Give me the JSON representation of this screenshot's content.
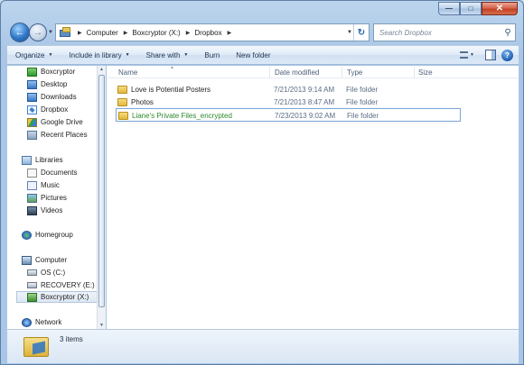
{
  "address": {
    "crumbs": [
      "Computer",
      "Boxcryptor (X:)",
      "Dropbox"
    ]
  },
  "search": {
    "placeholder": "Search Dropbox"
  },
  "toolbar": {
    "organize": "Organize",
    "include_in_library": "Include in library",
    "share_with": "Share with",
    "burn": "Burn",
    "new_folder": "New folder"
  },
  "sidebar": {
    "favorites": [
      {
        "label": "Boxcryptor",
        "icon": "boxcryptor-icon"
      },
      {
        "label": "Desktop",
        "icon": "desktop-icon"
      },
      {
        "label": "Downloads",
        "icon": "downloads-icon"
      },
      {
        "label": "Dropbox",
        "icon": "dropbox-icon"
      },
      {
        "label": "Google Drive",
        "icon": "google-drive-icon"
      },
      {
        "label": "Recent Places",
        "icon": "recent-places-icon"
      }
    ],
    "libraries": {
      "label": "Libraries",
      "items": [
        {
          "label": "Documents",
          "icon": "documents-icon"
        },
        {
          "label": "Music",
          "icon": "music-icon"
        },
        {
          "label": "Pictures",
          "icon": "pictures-icon"
        },
        {
          "label": "Videos",
          "icon": "videos-icon"
        }
      ]
    },
    "homegroup": "Homegroup",
    "computer": {
      "label": "Computer",
      "items": [
        {
          "label": "OS (C:)",
          "icon": "drive-icon"
        },
        {
          "label": "RECOVERY (E:)",
          "icon": "drive-icon"
        },
        {
          "label": "Boxcryptor (X:)",
          "icon": "boxcryptor-drive-icon",
          "selected": true
        }
      ]
    },
    "network": "Network"
  },
  "columns": {
    "name": "Name",
    "date": "Date modified",
    "type": "Type",
    "size": "Size"
  },
  "files": [
    {
      "name": "Love is Potential Posters",
      "date": "7/21/2013 9:14 AM",
      "type": "File folder",
      "encrypted": false
    },
    {
      "name": "Photos",
      "date": "7/21/2013 8:47 AM",
      "type": "File folder",
      "encrypted": false
    },
    {
      "name": "Liane's Private Files_encrypted",
      "date": "7/23/2013 9:02 AM",
      "type": "File folder",
      "encrypted": true,
      "selected": true
    }
  ],
  "details": {
    "count": "3 items"
  },
  "colors": {
    "encrypted_text": "#2c8a2c",
    "selection_border": "#7aa6d9"
  }
}
